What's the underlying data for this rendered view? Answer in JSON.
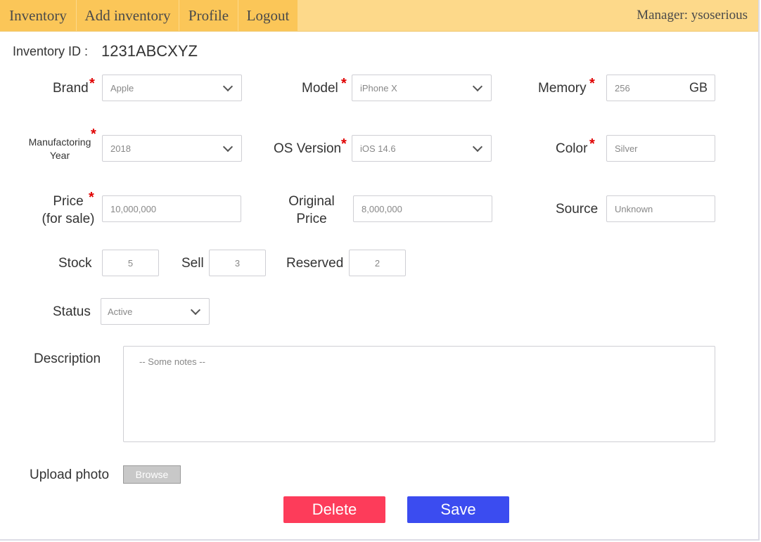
{
  "nav": {
    "tabs": [
      "Inventory",
      "Add inventory",
      "Profile",
      "Logout"
    ],
    "manager": "Manager: ysoserious"
  },
  "inventory_id": {
    "label": "Inventory ID :",
    "value": "1231ABCXYZ"
  },
  "form": {
    "brand": {
      "label": "Brand",
      "value": "Apple"
    },
    "model": {
      "label": "Model",
      "value": "iPhone X"
    },
    "memory": {
      "label": "Memory",
      "value": "256",
      "unit": "GB"
    },
    "manufacturing_year": {
      "label_line1": "Manufactoring",
      "label_line2": "Year",
      "value": "2018"
    },
    "os_version": {
      "label": "OS Version",
      "value": "iOS 14.6"
    },
    "color": {
      "label": "Color",
      "value": "Silver"
    },
    "price": {
      "label_line1": "Price",
      "label_line2": "(for sale)",
      "value": "10,000,000"
    },
    "original_price": {
      "label_line1": "Original",
      "label_line2": "Price",
      "value": "8,000,000"
    },
    "source": {
      "label": "Source",
      "value": "Unknown"
    },
    "stock": {
      "label": "Stock",
      "value": "5"
    },
    "sell": {
      "label": "Sell",
      "value": "3"
    },
    "reserved": {
      "label": "Reserved",
      "value": "2"
    },
    "status": {
      "label": "Status",
      "value": "Active"
    },
    "description": {
      "label": "Description",
      "placeholder": "-- Some notes --"
    },
    "upload": {
      "label": "Upload photo",
      "button": "Browse"
    }
  },
  "actions": {
    "delete": "Delete",
    "save": "Save"
  },
  "colors": {
    "nav_bg": "#fdd98a",
    "tab_bg": "#fbc658",
    "required": "#e00000",
    "delete": "#fd3c5a",
    "save": "#3b4cf0"
  },
  "icons": {
    "dropdown": "chevron-down-icon",
    "required": "asterisk-icon"
  }
}
